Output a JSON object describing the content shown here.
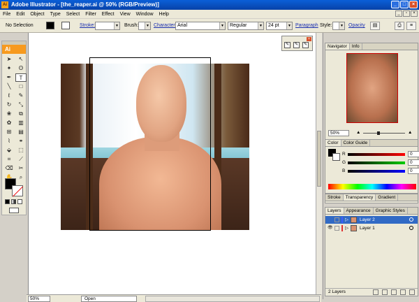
{
  "window": {
    "title": "Adobe Illustrator - [the_reaper.ai @ 50% (RGB/Preview)]",
    "app_icon": "Ai"
  },
  "menu": [
    "File",
    "Edit",
    "Object",
    "Type",
    "Select",
    "Filter",
    "Effect",
    "View",
    "Window",
    "Help"
  ],
  "control": {
    "selection": "No Selection",
    "stroke_label": "Stroke:",
    "brush_label": "Brush:",
    "character_label": "Character:",
    "font": "Arial",
    "font_style": "Regular",
    "font_size": "24 pt",
    "paragraph_label": "Paragraph",
    "style_label": "Style:",
    "opacity_label": "Opacity"
  },
  "toolbox": {
    "logo": "Ai"
  },
  "navigator": {
    "tabs": [
      "Navigator",
      "Info"
    ],
    "zoom": "50%"
  },
  "color": {
    "tabs": [
      "Color",
      "Color Guide"
    ],
    "channels": [
      {
        "label": "R",
        "value": "0"
      },
      {
        "label": "G",
        "value": "0"
      },
      {
        "label": "B",
        "value": "0"
      }
    ]
  },
  "transparency": {
    "tabs": [
      "Stroke",
      "Transparency",
      "Gradient"
    ]
  },
  "layers": {
    "tabs": [
      "Layers",
      "Appearance",
      "Graphic Styles"
    ],
    "items": [
      {
        "name": "Layer 2",
        "selected": true,
        "color": "#3c5cff"
      },
      {
        "name": "Layer 1",
        "selected": false,
        "color": "#e03030"
      }
    ],
    "count": "2 Layers"
  },
  "status": {
    "zoom": "50%",
    "state": "Open"
  }
}
